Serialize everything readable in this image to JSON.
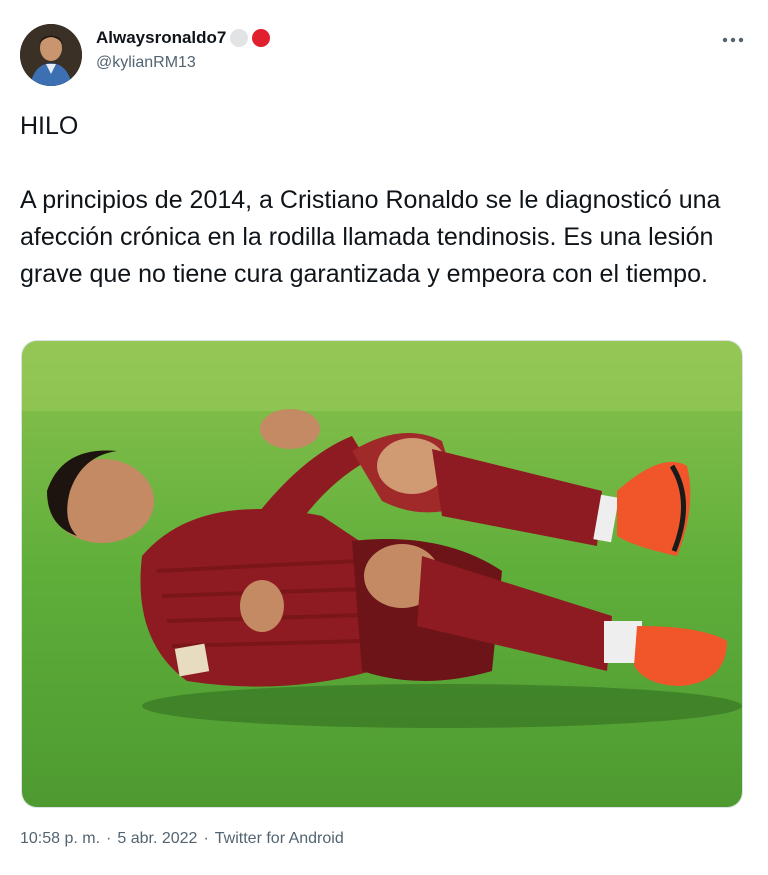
{
  "author": {
    "display_name": "Alwaysronaldo7",
    "handle": "@kylianRM13",
    "badge_colors": [
      "#e1e3e5",
      "#e0202e"
    ]
  },
  "tweet": {
    "text": "HILO\n\nA principios de 2014, a Cristiano Ronaldo se le diagnosticó una afección crónica en la rodilla llamada tendinosis. Es una lesión grave que no tiene cura garantizada y empeora con el tiempo."
  },
  "meta": {
    "time": "10:58 p. m.",
    "separator": "·",
    "date": "5 abr. 2022",
    "source": "Twitter for Android"
  },
  "icons": {
    "more": "more-horizontal-icon"
  },
  "colors": {
    "pitch": "#5aa83a",
    "kit": "#8e1b21",
    "boots": "#f0562a"
  }
}
